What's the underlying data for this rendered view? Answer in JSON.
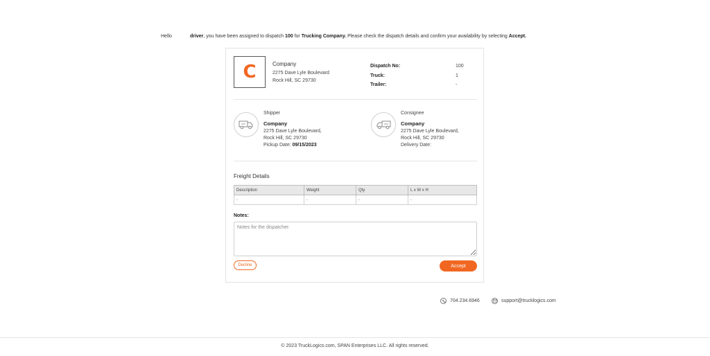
{
  "greeting": {
    "hello": "Hello",
    "driver": "driver",
    "text1": ", you have been assigned to dispatch ",
    "dispatch_no": "100",
    "text2": " for ",
    "company": "Trucking Company.",
    "text3": " Please check the dispatch details and confirm your availability by selecting ",
    "accept": "Accept."
  },
  "company": {
    "logo_letter": "C",
    "name": "Company",
    "address1": "2275 Dave Lyle Boulevard",
    "address2": "Rock Hill, SC 29730"
  },
  "dispatch": {
    "no_label": "Dispatch No:",
    "no_value": "100",
    "truck_label": "Truck:",
    "truck_value": "1",
    "trailer_label": "Trailer:",
    "trailer_value": "-"
  },
  "shipper": {
    "title": "Shipper",
    "name": "Company",
    "address1": "2275 Dave Lyle Boulevard,",
    "address2": "Rock Hill, SC 29730",
    "date_label": "Pickup Date: ",
    "date_value": "09/15/2023"
  },
  "consignee": {
    "title": "Consignee",
    "name": "Company",
    "address1": "2275 Dave Lyle Boulevard,",
    "address2": "Rock Hill, SC 29730",
    "date_label": "Delivery Date:",
    "date_value": ""
  },
  "freight": {
    "title": "Freight Details",
    "columns": [
      "Description",
      "Weight",
      "Qty",
      "L x W x H"
    ],
    "rows": [
      [
        "-",
        "-",
        "-",
        "-"
      ]
    ]
  },
  "notes": {
    "label": "Notes:",
    "placeholder": "Notes for the dispatcher.",
    "value": ""
  },
  "buttons": {
    "decline": "Decline",
    "accept": "Accept"
  },
  "contact": {
    "phone": "704.234.6946",
    "email": "support@trucklogics.com"
  },
  "footer": {
    "copyright": "© 2023 TruckLogics.com, SPAN Enterprises LLC. All rights reserved."
  },
  "colors": {
    "accent": "#f16722",
    "border": "#e2e2e2"
  },
  "icons": {
    "shipper": "truck-icon",
    "consignee": "truck-icon",
    "phone": "phone-icon",
    "email": "mail-icon"
  }
}
